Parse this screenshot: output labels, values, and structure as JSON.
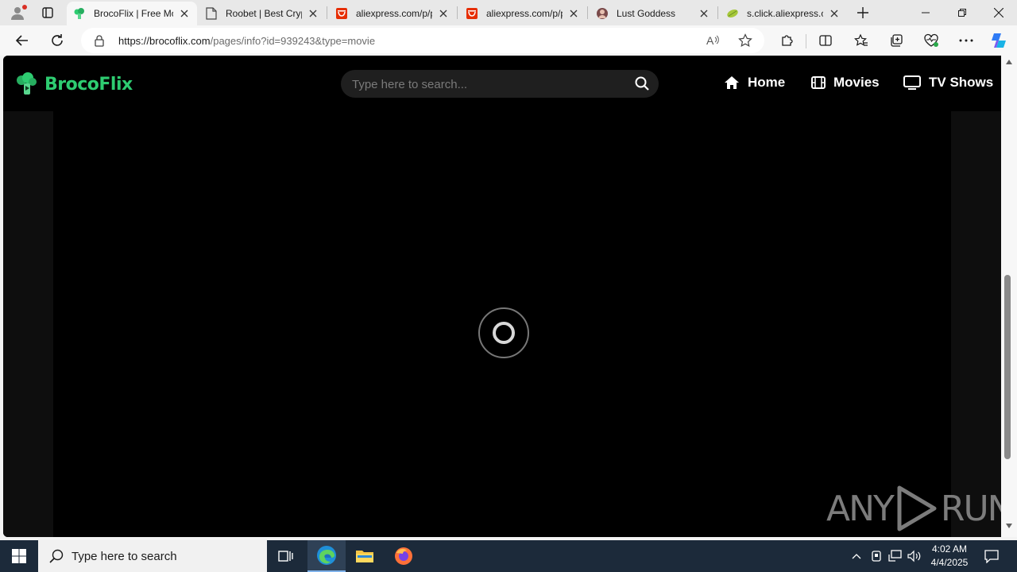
{
  "browser": {
    "tabs": [
      {
        "title": "BrocoFlix | Free Mo",
        "favicon": "broccoli-icon",
        "active": true
      },
      {
        "title": "Roobet | Best Cryp",
        "favicon": "page-icon",
        "active": false
      },
      {
        "title": "aliexpress.com/p/p",
        "favicon": "aliexpress-icon",
        "active": false
      },
      {
        "title": "aliexpress.com/p/p",
        "favicon": "aliexpress-icon",
        "active": false
      },
      {
        "title": "Lust Goddess",
        "favicon": "avatar-icon",
        "active": false
      },
      {
        "title": "s.click.aliexpress.co",
        "favicon": "leaf-icon",
        "active": false
      }
    ],
    "url_host": "https://brocoflix.com",
    "url_path": "/pages/info?id=939243&type=movie"
  },
  "site": {
    "brand": "BrocoFlix",
    "search_placeholder": "Type here to search...",
    "nav": {
      "home": "Home",
      "movies": "Movies",
      "tv_shows": "TV Shows"
    },
    "watermark_left": "ANY",
    "watermark_right": "RUN",
    "brand_color": "#2ecc71"
  },
  "taskbar": {
    "search_text": "Type here to search",
    "time": "4:02 AM",
    "date": "4/4/2025"
  }
}
